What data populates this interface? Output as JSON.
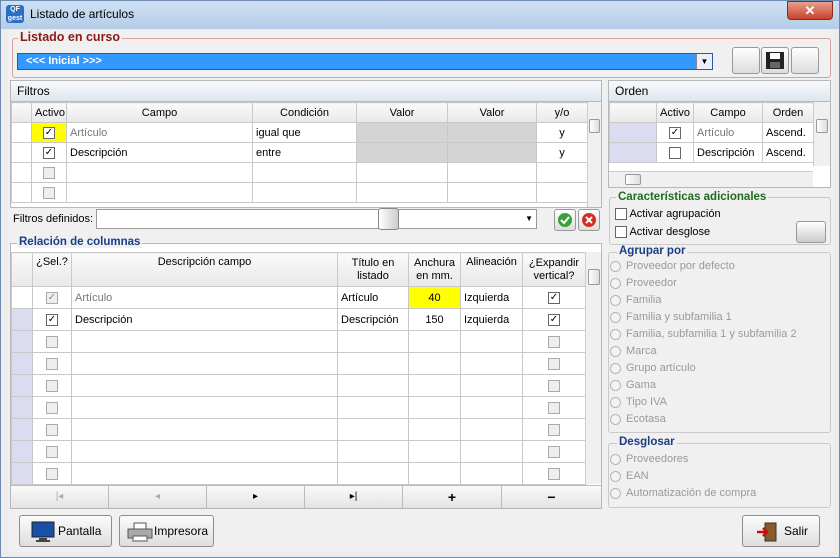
{
  "window": {
    "title": "Listado de artículos",
    "close": "✕"
  },
  "listado": {
    "label": "Listado en curso",
    "value": "<<< Inicial >>>"
  },
  "filtros": {
    "title": "Filtros",
    "headers": [
      "Activo",
      "Campo",
      "Condición",
      "Valor",
      "Valor",
      "y/o"
    ],
    "rows": [
      {
        "activo": true,
        "campo": "Artículo",
        "condicion": "igual que",
        "yo": "y"
      },
      {
        "activo": true,
        "campo": "Descripción",
        "condicion": "entre",
        "yo": "y"
      }
    ],
    "definidos_label": "Filtros definidos:"
  },
  "orden": {
    "title": "Orden",
    "headers": [
      "Activo",
      "Campo",
      "Orden"
    ],
    "rows": [
      {
        "activo": true,
        "campo": "Artículo",
        "orden": "Ascend."
      },
      {
        "activo": false,
        "campo": "Descripción",
        "orden": "Ascend."
      }
    ]
  },
  "caracteristicas": {
    "title": "Características adicionales",
    "agrupacion": "Activar agrupación",
    "desglose": "Activar desglose"
  },
  "agrupar": {
    "title": "Agrupar por",
    "options": [
      "Proveedor por defecto",
      "Proveedor",
      "Familia",
      "Familia y subfamilia 1",
      "Familia, subfamilia 1 y subfamilia 2",
      "Marca",
      "Grupo artículo",
      "Gama",
      "Tipo IVA",
      "Ecotasa"
    ]
  },
  "desglosar": {
    "title": "Desglosar",
    "options": [
      "Proveedores",
      "EAN",
      "Automatización de compra"
    ]
  },
  "columnas": {
    "title": "Relación de columnas",
    "headers": {
      "sel": "¿Sel.?",
      "desc": "Descripción campo",
      "titulo1": "Título en",
      "titulo2": "listado",
      "anch1": "Anchura",
      "anch2": "en mm.",
      "alin": "Alineación",
      "exp1": "¿Expandir",
      "exp2": "vertical?"
    },
    "rows": [
      {
        "desc": "Artículo",
        "titulo": "Artículo",
        "anchura": "40",
        "alineacion": "Izquierda"
      },
      {
        "desc": "Descripción",
        "titulo": "Descripción",
        "anchura": "150",
        "alineacion": "Izquierda"
      }
    ]
  },
  "nav": [
    "|◂",
    "◂",
    "▸",
    "▸|",
    "+",
    "−"
  ],
  "buttons": {
    "pantalla": "Pantalla",
    "impresora": "Impresora",
    "salir": "Salir"
  },
  "colors": {
    "accent": "#3399ff",
    "label_red": "#8b1a1a",
    "label_blue": "#1b3d86",
    "label_green": "#1e6b1e",
    "highlight": "#ffff00"
  }
}
